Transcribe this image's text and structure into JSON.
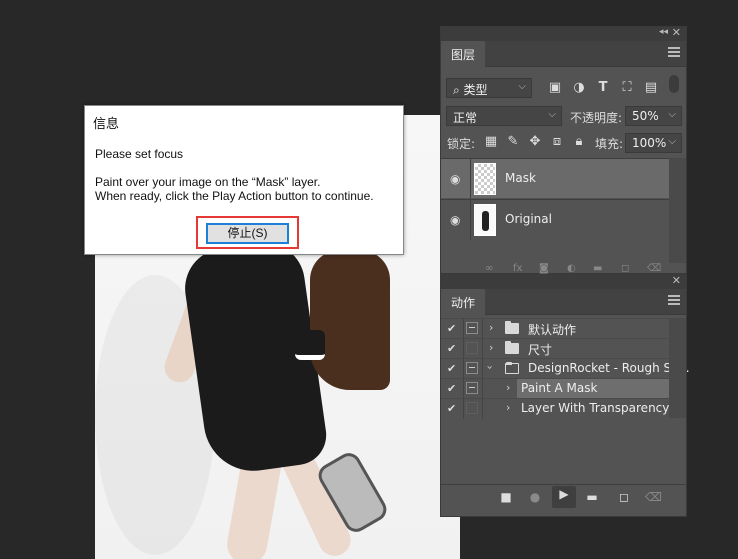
{
  "layers_panel": {
    "tab": "图层",
    "filter_kind": "类型",
    "blend_mode": "正常",
    "opacity_label": "不透明度:",
    "opacity_value": "50%",
    "lock_label": "锁定:",
    "fill_label": "填充:",
    "fill_value": "100%",
    "layers": [
      {
        "name": "Mask",
        "selected": true,
        "visible": true
      },
      {
        "name": "Original",
        "selected": false,
        "visible": true
      }
    ],
    "footer_icons": [
      "link-icon",
      "fx-icon",
      "mask-icon",
      "adjustment-icon",
      "group-icon",
      "new-layer-icon",
      "trash-icon"
    ]
  },
  "actions_panel": {
    "tab": "动作",
    "items": [
      {
        "name": "默认动作",
        "checked": true,
        "dialog": true,
        "expanded": false,
        "type": "set",
        "selected": false
      },
      {
        "name": "尺寸",
        "checked": true,
        "dialog": false,
        "expanded": false,
        "type": "set",
        "selected": false
      },
      {
        "name": "DesignRocket - Rough Sk...",
        "checked": true,
        "dialog": true,
        "expanded": true,
        "type": "set",
        "selected": false
      },
      {
        "name": "Paint A Mask",
        "checked": true,
        "dialog": true,
        "expanded": false,
        "type": "action",
        "selected": true
      },
      {
        "name": "Layer With Transparency",
        "checked": true,
        "dialog": false,
        "expanded": false,
        "type": "action",
        "selected": false
      }
    ],
    "toolbar": [
      "stop-icon",
      "record-icon",
      "play-icon",
      "new-set-icon",
      "new-action-icon",
      "delete-icon"
    ]
  },
  "dialog": {
    "title": "信息",
    "line1": "Please set focus",
    "line2": "Paint over your image on the “Mask” layer.",
    "line3": "When ready, click the Play Action button to continue.",
    "stop_button": "停止(S)"
  },
  "colors": {
    "canvas_bg": "#282828",
    "panel_bg": "#535353",
    "selected_layer": "#6a6a6a",
    "highlight_red": "#e53935",
    "button_focus": "#1e7fd8"
  }
}
